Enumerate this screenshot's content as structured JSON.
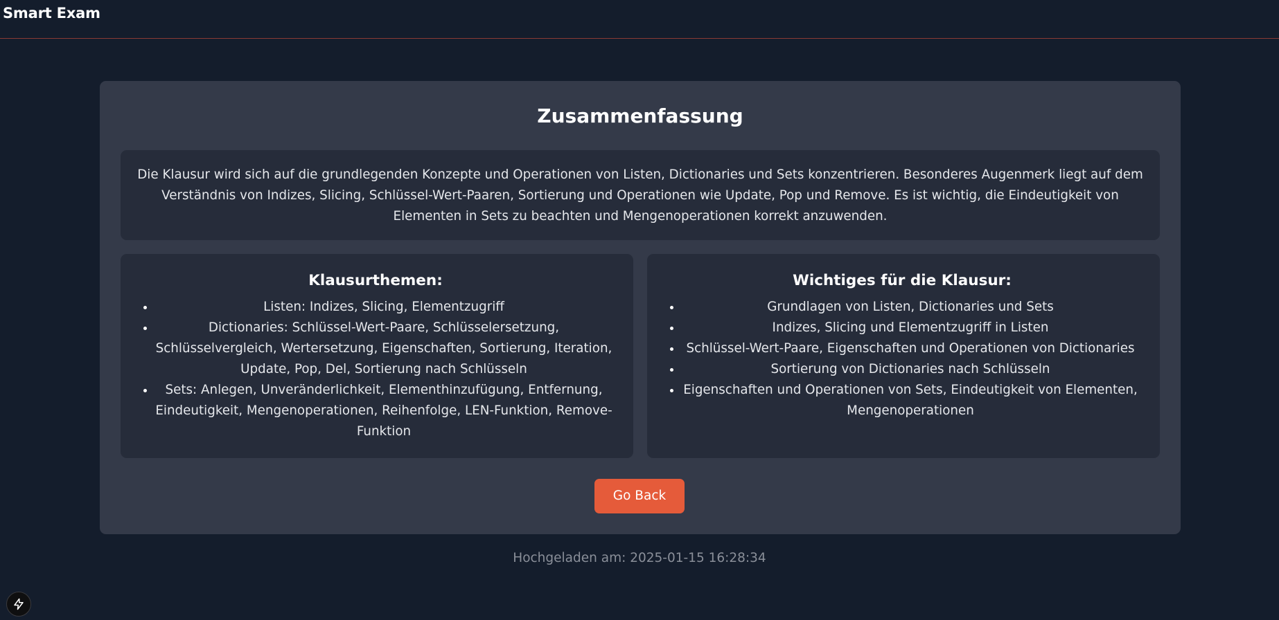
{
  "app": {
    "title": "Smart Exam"
  },
  "summary": {
    "heading": "Zusammenfassung",
    "text": "Die Klausur wird sich auf die grundlegenden Konzepte und Operationen von Listen, Dictionaries und Sets konzentrieren. Besonderes Augenmerk liegt auf dem Verständnis von Indizes, Slicing, Schlüssel-Wert-Paaren, Sortierung und Operationen wie Update, Pop und Remove. Es ist wichtig, die Eindeutigkeit von Elementen in Sets zu beachten und Mengenoperationen korrekt anzuwenden."
  },
  "topics": {
    "heading": "Klausurthemen:",
    "items": [
      "Listen: Indizes, Slicing, Elementzugriff",
      "Dictionaries: Schlüssel-Wert-Paare, Schlüsselersetzung, Schlüsselvergleich, Wertersetzung, Eigenschaften, Sortierung, Iteration, Update, Pop, Del, Sortierung nach Schlüsseln",
      "Sets: Anlegen, Unveränderlichkeit, Elementhinzufügung, Entfernung, Eindeutigkeit, Mengenoperationen, Reihenfolge, LEN-Funktion, Remove-Funktion"
    ]
  },
  "important": {
    "heading": "Wichtiges für die Klausur:",
    "items": [
      "Grundlagen von Listen, Dictionaries und Sets",
      "Indizes, Slicing und Elementzugriff in Listen",
      "Schlüssel-Wert-Paare, Eigenschaften und Operationen von Dictionaries",
      "Sortierung von Dictionaries nach Schlüsseln",
      "Eigenschaften und Operationen von Sets, Eindeutigkeit von Elementen, Mengenoperationen"
    ]
  },
  "actions": {
    "go_back_label": "Go Back"
  },
  "footer": {
    "uploaded": "Hochgeladen am: 2025-01-15 16:28:34"
  },
  "icons": {
    "dev_indicator": "lightning-bolt-icon"
  },
  "colors": {
    "background": "#141d2c",
    "card": "#343a49",
    "panel": "#262c3a",
    "accent": "#e55b3a",
    "header_rule": "#8a3a35"
  }
}
